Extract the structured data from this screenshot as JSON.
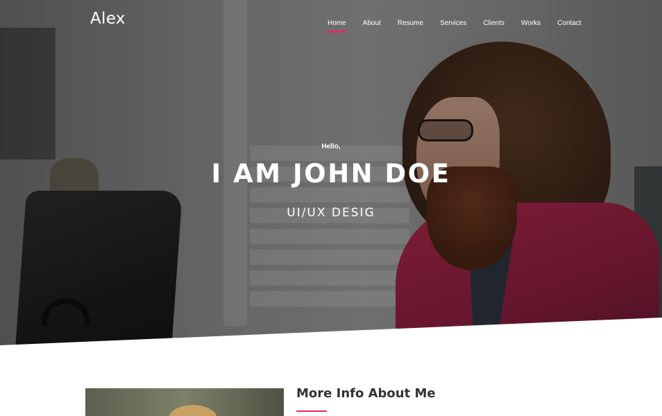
{
  "header": {
    "logo": "Alex",
    "nav": [
      {
        "label": "Home",
        "active": true
      },
      {
        "label": "About",
        "active": false
      },
      {
        "label": "Resume",
        "active": false
      },
      {
        "label": "Services",
        "active": false
      },
      {
        "label": "Clients",
        "active": false
      },
      {
        "label": "Works",
        "active": false
      },
      {
        "label": "Contact",
        "active": false
      }
    ]
  },
  "hero": {
    "greeting": "Hello,",
    "headline": "I AM JOHN DOE",
    "role": "UI/UX DESIG"
  },
  "about": {
    "title": "More Info About Me"
  },
  "colors": {
    "accent": "#e0305c",
    "text_dark": "#333333",
    "text_light": "#ffffff"
  }
}
